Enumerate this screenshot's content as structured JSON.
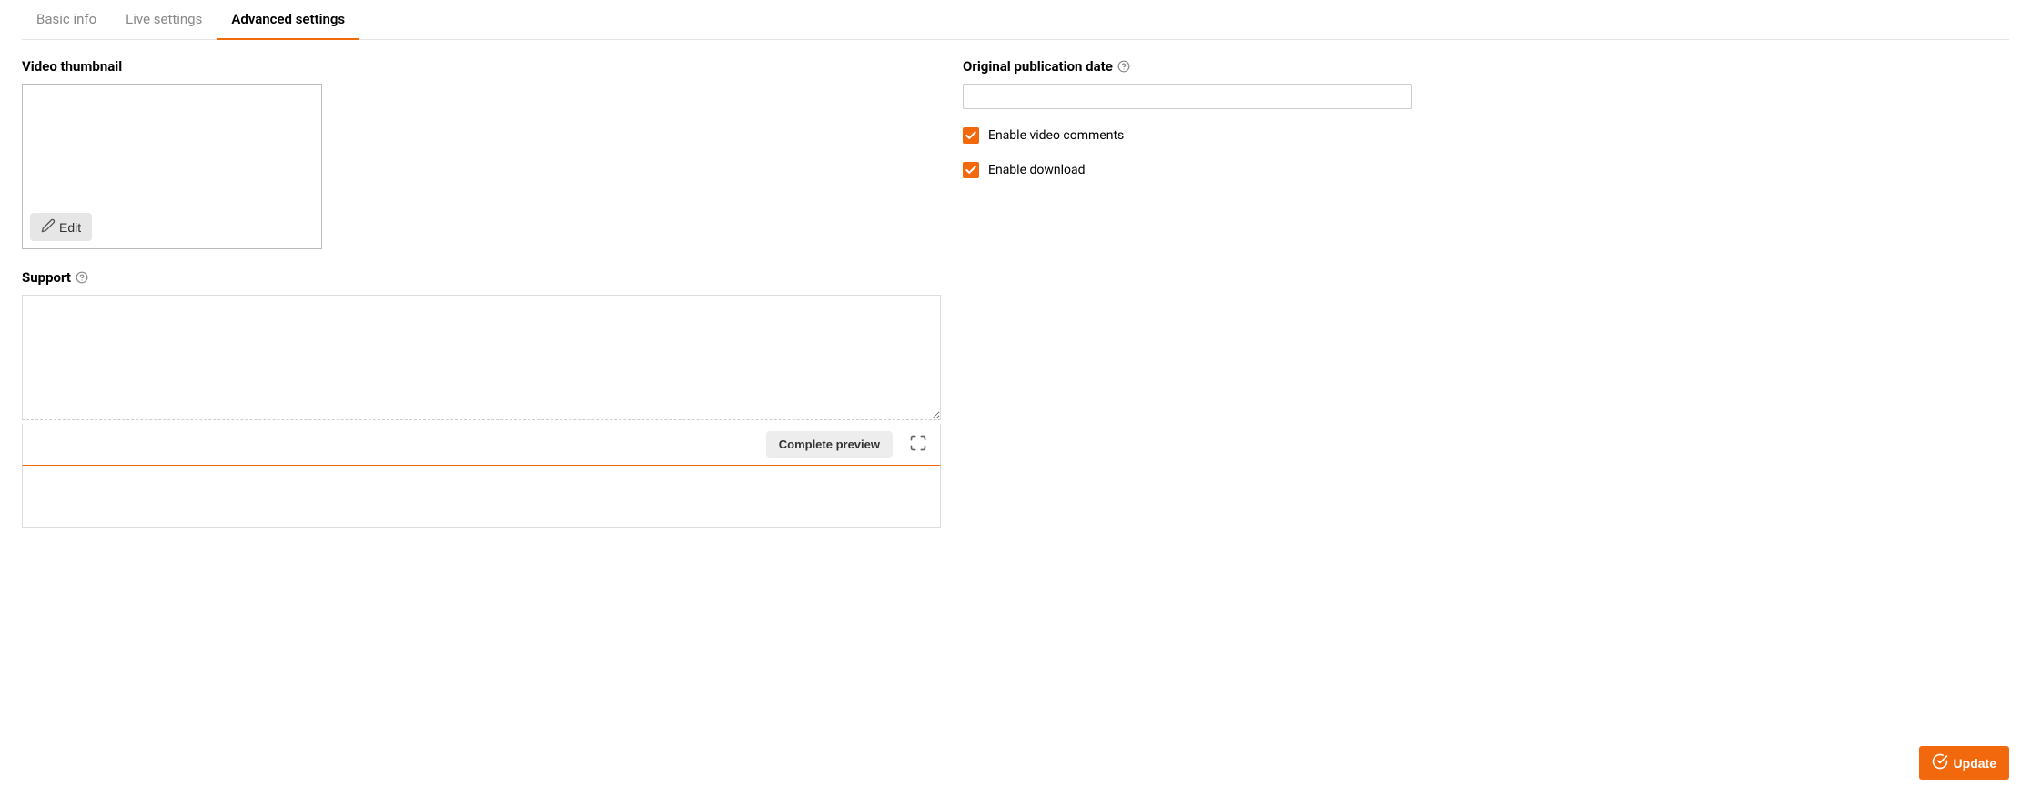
{
  "tabs": {
    "basic_info": "Basic info",
    "live_settings": "Live settings",
    "advanced_settings": "Advanced settings"
  },
  "left": {
    "thumbnail_label": "Video thumbnail",
    "edit_label": "Edit",
    "support_label": "Support",
    "support_value": "",
    "preview_label": "Complete preview"
  },
  "right": {
    "pub_date_label": "Original publication date",
    "pub_date_value": "",
    "comments_label": "Enable video comments",
    "download_label": "Enable download"
  },
  "footer": {
    "update_label": "Update"
  },
  "colors": {
    "accent": "#f1680d"
  }
}
